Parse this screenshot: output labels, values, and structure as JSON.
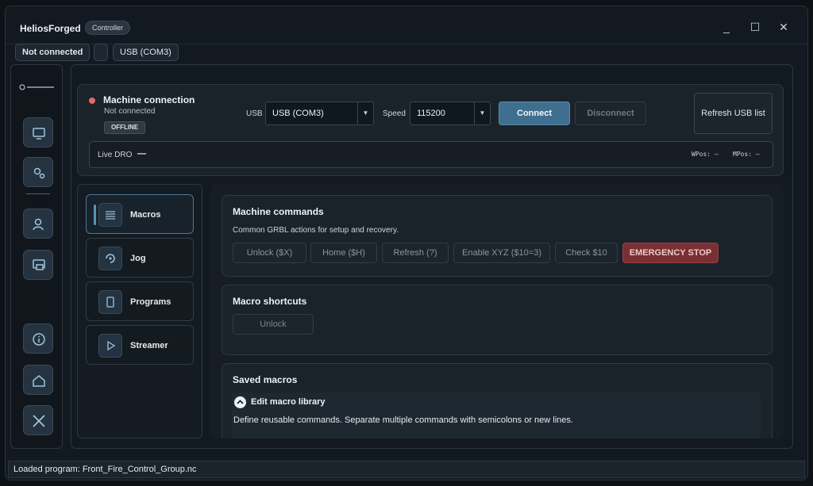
{
  "app": {
    "title": "HeliosForged",
    "badge": "Controller"
  },
  "window_controls": {
    "minimize": "_",
    "maximize": "☐",
    "close": "✕"
  },
  "status_row": {
    "connection": "Not connected",
    "port": "USB (COM3)"
  },
  "connection": {
    "title": "Machine connection",
    "subtitle": "Not connected",
    "badge": "OFFLINE",
    "status_color": "#e06b6b",
    "usb_label": "USB",
    "usb_value": "USB (COM3)",
    "speed_label": "Speed",
    "speed_value": "115200",
    "connect_label": "Connect",
    "disconnect_label": "Disconnect",
    "refresh_label": "Refresh USB list",
    "dro_label": "Live DRO",
    "dro_value": "—",
    "wpos": "WPos: —",
    "mpos": "MPos: —"
  },
  "nav": {
    "items": [
      {
        "label": "Macros",
        "icon": "list-icon",
        "active": true
      },
      {
        "label": "Jog",
        "icon": "jog-icon"
      },
      {
        "label": "Programs",
        "icon": "document-icon"
      },
      {
        "label": "Streamer",
        "icon": "play-icon"
      }
    ]
  },
  "machine_commands": {
    "title": "Machine commands",
    "subtitle": "Common GRBL actions for setup and recovery.",
    "buttons": [
      "Unlock ($X)",
      "Home ($H)",
      "Refresh (?)",
      "Enable XYZ ($10=3)",
      "Check $10",
      "EMERGENCY STOP"
    ]
  },
  "macro_shortcuts": {
    "title": "Macro shortcuts",
    "unlock_label": "Unlock"
  },
  "saved_macros": {
    "title": "Saved macros",
    "expander_label": "Edit macro library",
    "description": "Define reusable commands. Separate multiple commands with semicolons or new lines."
  },
  "status_bar": {
    "text": "Loaded program: Front_Fire_Control_Group.nc"
  },
  "colors": {
    "accent": "#3f6f8f",
    "danger": "#7a2f33",
    "background": "#121920"
  }
}
